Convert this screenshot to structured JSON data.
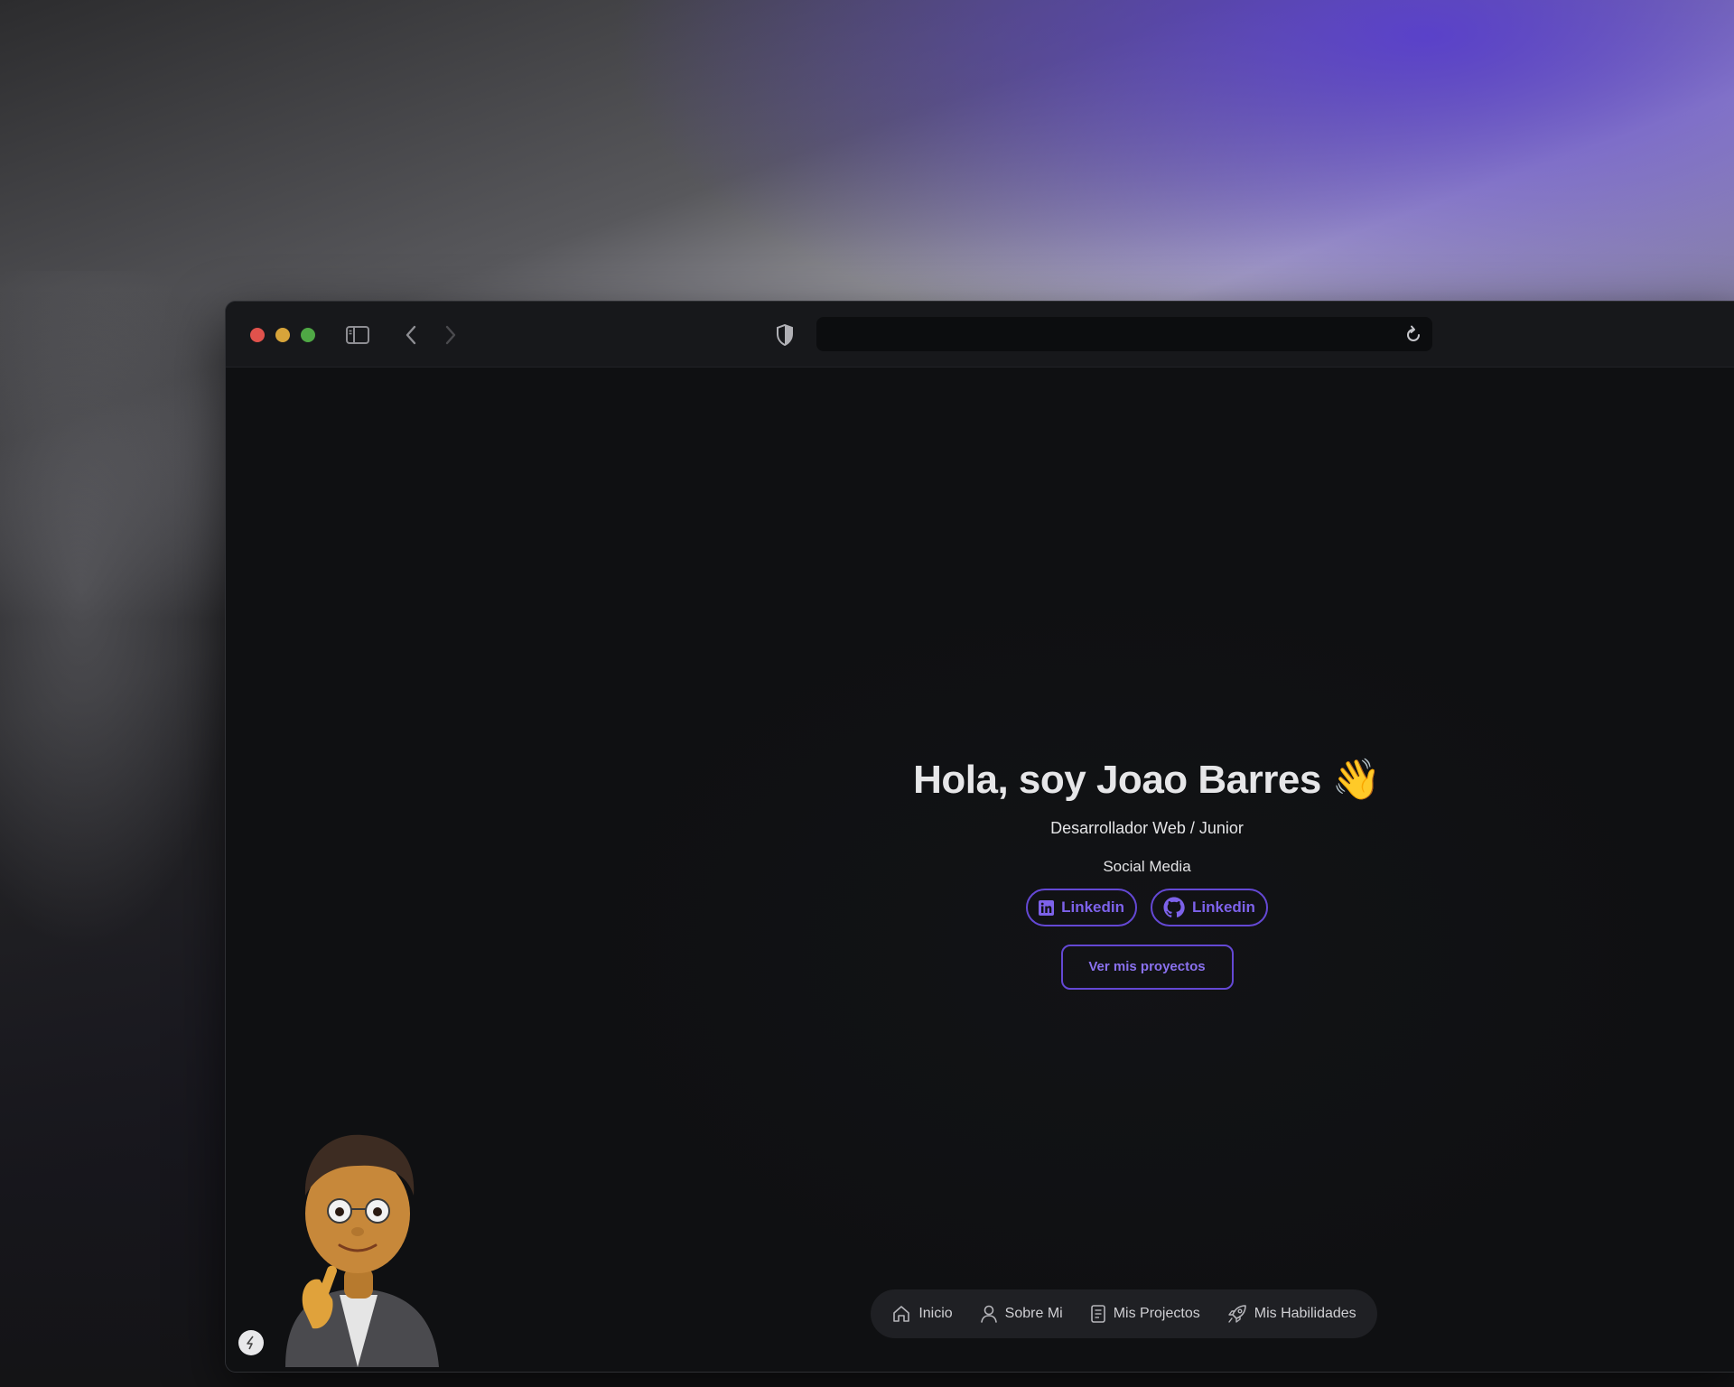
{
  "window": {
    "traffic_lights": [
      "close",
      "minimize",
      "zoom"
    ],
    "address_bar": {
      "url": ""
    }
  },
  "hero": {
    "title": "Hola, soy Joao Barres",
    "title_emoji": "👋",
    "subtitle": "Desarrollador Web / Junior",
    "social_heading": "Social Media",
    "social_links": [
      {
        "label": "Linkedin",
        "icon": "linkedin-icon"
      },
      {
        "label": "Linkedin",
        "icon": "github-icon"
      }
    ],
    "cta_label": "Ver mis proyectos"
  },
  "nav": {
    "items": [
      {
        "label": "Inicio",
        "icon": "home-icon"
      },
      {
        "label": "Sobre Mi",
        "icon": "user-icon"
      },
      {
        "label": "Mis Projectos",
        "icon": "document-icon"
      },
      {
        "label": "Mis Habilidades",
        "icon": "rocket-icon"
      }
    ]
  },
  "colors": {
    "accent": "#6448d4",
    "accent_text": "#7d62ea",
    "page_bg": "#101114"
  }
}
